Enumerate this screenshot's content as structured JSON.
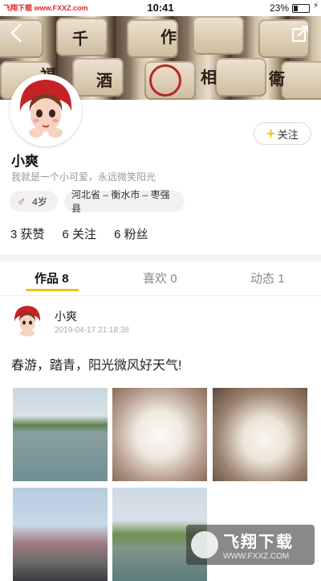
{
  "status_bar": {
    "brand": "飞翔下载 www.FXXZ.com",
    "time": "10:41",
    "battery": "23%"
  },
  "cover": {
    "kanji": [
      "福",
      "酒",
      "作",
      "相",
      "衛",
      "千"
    ]
  },
  "profile": {
    "follow_label": "关注",
    "name": "小爽",
    "bio": "我就是一个小可爱，永远微笑阳光",
    "age": "4岁",
    "location": "河北省 – 衡水市 – 枣强县",
    "stats": [
      {
        "count": "3",
        "label": "获赞"
      },
      {
        "count": "6",
        "label": "关注"
      },
      {
        "count": "6",
        "label": "粉丝"
      }
    ]
  },
  "tabs": [
    {
      "label": "作品",
      "count": "8"
    },
    {
      "label": "喜欢",
      "count": "0"
    },
    {
      "label": "动态",
      "count": "1"
    }
  ],
  "post": {
    "author": "小爽",
    "time": "2019-04-17 21:18:38",
    "text": "春游，踏青，阳光微风好天气!"
  },
  "watermark": {
    "title": "飞翔下载",
    "url": "WWW.FXXZ.COM"
  },
  "colors": {
    "accent": "#f5c400",
    "gender": "#d633b8"
  }
}
